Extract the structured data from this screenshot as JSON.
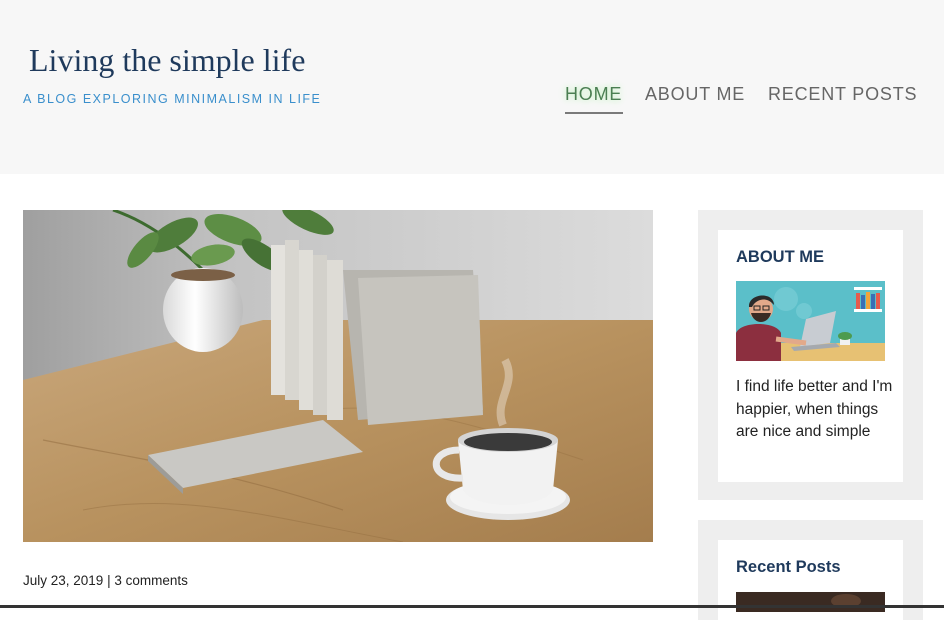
{
  "site": {
    "title": "Living the simple life",
    "tagline": "A BLOG EXPLORING MINIMALISM IN LIFE"
  },
  "nav": {
    "items": [
      {
        "label": "HOME",
        "active": true
      },
      {
        "label": "ABOUT ME",
        "active": false
      },
      {
        "label": "RECENT POSTS",
        "active": false
      }
    ]
  },
  "post": {
    "date": "July 23, 2019",
    "separator": " | ",
    "comments": "3 comments"
  },
  "sidebar": {
    "about": {
      "title": "ABOUT ME",
      "text": "I find life better and I'm happier, when things are nice and simple"
    },
    "recent": {
      "title": "Recent Posts"
    }
  },
  "colors": {
    "header_bg": "#f7f7f7",
    "title": "#1f3a5c",
    "tagline": "#3a8fcc",
    "nav_active": "#4b7f52",
    "widget_bg": "#eeeeee"
  }
}
